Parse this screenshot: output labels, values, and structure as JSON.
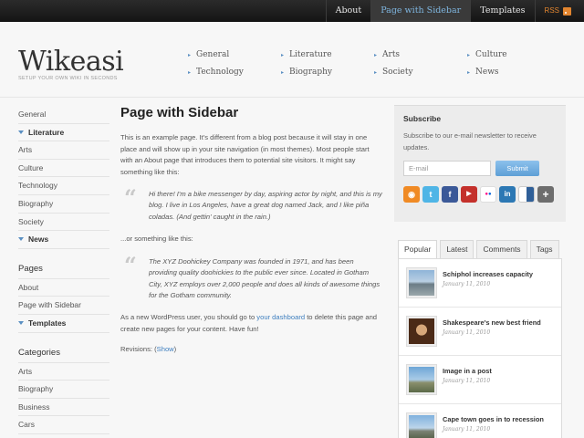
{
  "topnav": {
    "items": [
      {
        "label": "About"
      },
      {
        "label": "Page with Sidebar",
        "active": true
      },
      {
        "label": "Templates"
      },
      {
        "label": "RSS",
        "icon": "rss-icon"
      }
    ]
  },
  "header": {
    "logo": "Wikeasi",
    "tagline": "SETUP YOUR OWN WIKI IN SECONDS",
    "categories": [
      "General",
      "Literature",
      "Arts",
      "Culture",
      "Technology",
      "Biography",
      "Society",
      "News"
    ]
  },
  "leftnav": {
    "group1": [
      "General",
      "Literature",
      "Arts",
      "Culture",
      "Technology",
      "Biography",
      "Society",
      "News"
    ],
    "pages_title": "Pages",
    "pages": [
      "About",
      "Page with Sidebar",
      "Templates"
    ],
    "categories_title": "Categories",
    "categories": [
      "Arts",
      "Biography",
      "Business",
      "Cars"
    ]
  },
  "main": {
    "title": "Page with Sidebar",
    "intro": "This is an example page. It's different from a blog post because it will stay in one place and will show up in your site navigation (in most themes). Most people start with an About page that introduces them to potential site visitors. It might say something like this:",
    "quote1": "Hi there! I'm a bike messenger by day, aspiring actor by night, and this is my blog. I live in Los Angeles, have a great dog named Jack, and I like piña coladas. (And gettin' caught in the rain.)",
    "between": "...or something like this:",
    "quote2": "The XYZ Doohickey Company was founded in 1971, and has been providing quality doohickies to the public ever since. Located in Gotham City, XYZ employs over 2,000 people and does all kinds of awesome things for the Gotham community.",
    "outro_before": "As a new WordPress user, you should go to ",
    "outro_link": "your dashboard",
    "outro_after": " to delete this page and create new pages for your content. Have fun!",
    "revisions_label": "Revisions: (",
    "revisions_link": "Show",
    "revisions_close": ")"
  },
  "subscribe": {
    "title": "Subscribe",
    "text": "Subscribe to our e-mail newsletter to receive updates.",
    "placeholder": "E-mail",
    "button": "Submit",
    "icons": [
      {
        "name": "rss-icon",
        "color": "#f08a24",
        "glyph": "◉"
      },
      {
        "name": "twitter-icon",
        "color": "#4fb5e6",
        "glyph": "t"
      },
      {
        "name": "facebook-icon",
        "color": "#3b5998",
        "glyph": "f"
      },
      {
        "name": "youtube-icon",
        "color": "#c4302b",
        "glyph": "▶"
      },
      {
        "name": "flickr-icon",
        "color": "#ffffff",
        "glyph": "●●"
      },
      {
        "name": "linkedin-icon",
        "color": "#2c78b4",
        "glyph": "in"
      },
      {
        "name": "delicious-icon",
        "color": "#2f5f98",
        "glyph": "■"
      },
      {
        "name": "plus-icon",
        "color": "#6d6d6d",
        "glyph": "+"
      }
    ]
  },
  "tabs": {
    "items": [
      "Popular",
      "Latest",
      "Comments",
      "Tags"
    ],
    "posts": [
      {
        "title": "Schiphol increases capacity",
        "date": "January 11, 2010"
      },
      {
        "title": "Shakespeare's new best friend",
        "date": "January 11, 2010"
      },
      {
        "title": "Image in a post",
        "date": "January 11, 2010"
      },
      {
        "title": "Cape town goes in to recession",
        "date": "January 11, 2010"
      }
    ]
  },
  "colors": {
    "accent": "#5a8fc2",
    "link": "#3f7fbf",
    "topbar": "#1e1e1e",
    "rss": "#e2852f"
  }
}
